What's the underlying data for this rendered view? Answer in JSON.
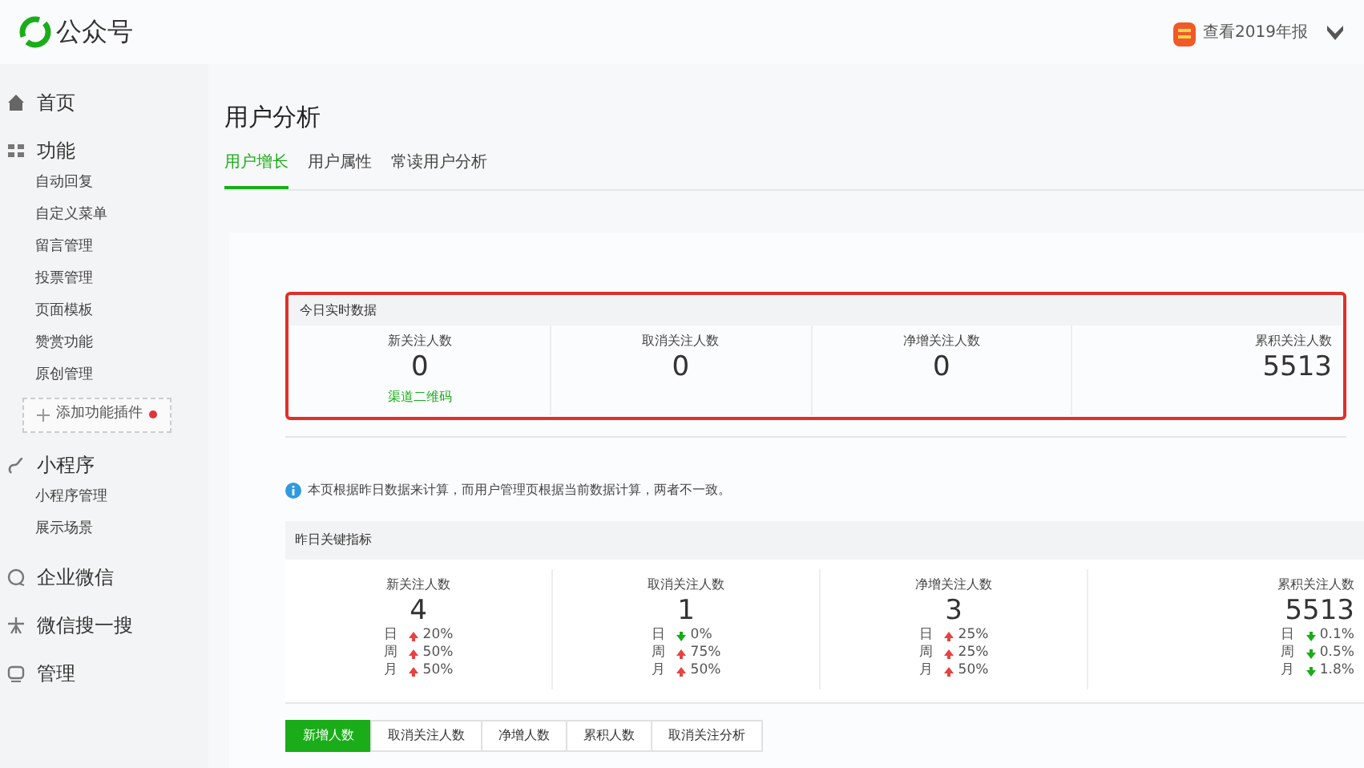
{
  "header": {
    "brand": "公众号",
    "annual_report": "查看2019年报"
  },
  "sidebar": [
    {
      "label": "首页"
    },
    {
      "label": "功能",
      "children": [
        {
          "label": "自动回复"
        },
        {
          "label": "自定义菜单"
        },
        {
          "label": "留言管理"
        },
        {
          "label": "投票管理"
        },
        {
          "label": "页面模板"
        },
        {
          "label": "赞赏功能"
        },
        {
          "label": "原创管理"
        }
      ],
      "add_plugin": {
        "label": "添加功能插件",
        "dot": true
      }
    },
    {
      "label": "小程序",
      "children": [
        {
          "label": "小程序管理"
        },
        {
          "label": "展示场景"
        }
      ]
    },
    {
      "label": "企业微信"
    },
    {
      "label": "微信搜一搜"
    },
    {
      "label": "管理"
    }
  ],
  "page": {
    "title": "用户分析",
    "tabs": [
      {
        "label": "用户增长",
        "selected": true
      },
      {
        "label": "用户属性",
        "selected": false
      },
      {
        "label": "常读用户分析",
        "selected": false
      }
    ],
    "realtime": {
      "title": "今日实时数据",
      "highlighted": true,
      "metrics": [
        {
          "label": "新关注人数",
          "value": "0",
          "link": "渠道二维码"
        },
        {
          "label": "取消关注人数",
          "value": "0"
        },
        {
          "label": "净增关注人数",
          "value": "0"
        },
        {
          "label": "累积关注人数",
          "value": "5513"
        }
      ]
    },
    "notice": "本页根据昨日数据来计算，而用户管理页根据当前数据计算，两者不一致。",
    "yesterday": {
      "title": "昨日关键指标",
      "metrics": [
        {
          "label": "新关注人数",
          "value": "4",
          "changes": [
            {
              "period": "日",
              "kind": "up",
              "pct": "20%"
            },
            {
              "period": "周",
              "kind": "up",
              "pct": "50%"
            },
            {
              "period": "月",
              "kind": "up",
              "pct": "50%"
            }
          ]
        },
        {
          "label": "取消关注人数",
          "value": "1",
          "changes": [
            {
              "period": "日",
              "kind": "down",
              "pct": "0%"
            },
            {
              "period": "周",
              "kind": "up",
              "pct": "75%"
            },
            {
              "period": "月",
              "kind": "up",
              "pct": "50%"
            }
          ]
        },
        {
          "label": "净增关注人数",
          "value": "3",
          "changes": [
            {
              "period": "日",
              "kind": "up",
              "pct": "25%"
            },
            {
              "period": "周",
              "kind": "up",
              "pct": "25%"
            },
            {
              "period": "月",
              "kind": "up",
              "pct": "50%"
            }
          ]
        },
        {
          "label": "累积关注人数",
          "value": "5513",
          "changes": [
            {
              "period": "日",
              "kind": "down",
              "pct": "0.1%"
            },
            {
              "period": "周",
              "kind": "down",
              "pct": "0.5%"
            },
            {
              "period": "月",
              "kind": "down",
              "pct": "1.8%"
            }
          ]
        }
      ]
    },
    "chart_tabs": [
      {
        "label": "新增人数",
        "selected": true
      },
      {
        "label": "取消关注人数",
        "selected": false
      },
      {
        "label": "净增人数",
        "selected": false
      },
      {
        "label": "累积人数",
        "selected": false
      },
      {
        "label": "取消关注分析",
        "selected": false
      }
    ]
  }
}
